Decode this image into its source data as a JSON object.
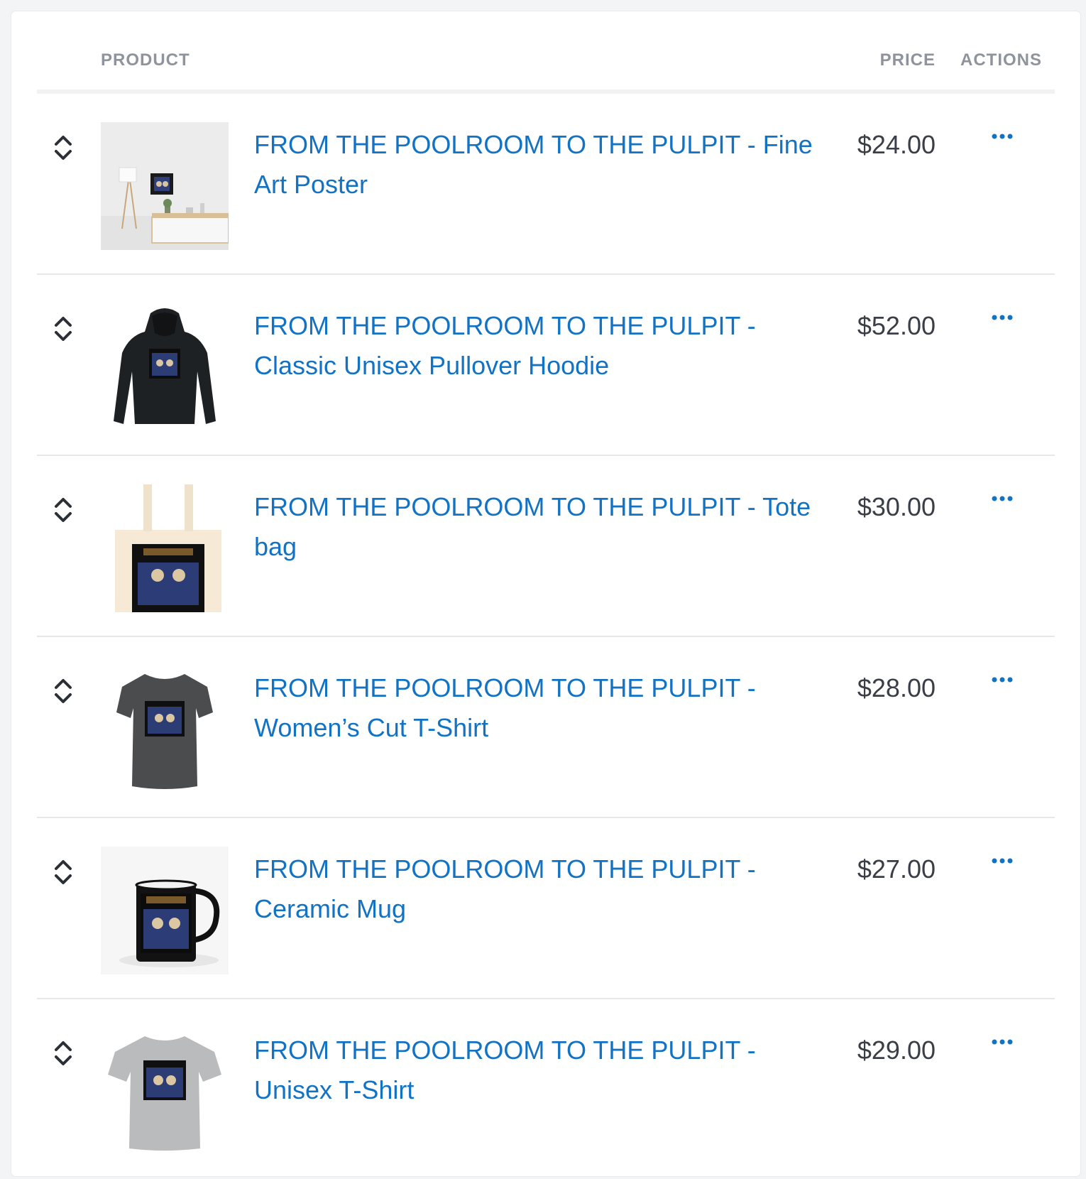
{
  "table": {
    "columns": {
      "product": "PRODUCT",
      "price": "PRICE",
      "actions": "ACTIONS"
    },
    "rows": [
      {
        "name": "FROM THE POOLROOM TO THE PULPIT - Fine Art Poster",
        "price": "$24.00",
        "image": "poster-in-room"
      },
      {
        "name": "FROM THE POOLROOM TO THE PULPIT - Classic Unisex Pullover Hoodie",
        "price": "$52.00",
        "image": "black-hoodie"
      },
      {
        "name": "FROM THE POOLROOM TO THE PULPIT - Tote bag",
        "price": "$30.00",
        "image": "natural-tote-bag"
      },
      {
        "name": "FROM THE POOLROOM TO THE PULPIT - Women’s Cut T-Shirt",
        "price": "$28.00",
        "image": "dark-grey-womens-tshirt"
      },
      {
        "name": "FROM THE POOLROOM TO THE PULPIT - Ceramic Mug",
        "price": "$27.00",
        "image": "black-ceramic-mug"
      },
      {
        "name": "FROM THE POOLROOM TO THE PULPIT - Unisex T-Shirt",
        "price": "$29.00",
        "image": "light-grey-unisex-tshirt"
      }
    ]
  },
  "icons": {
    "sort": "sort-handle-icon",
    "actions": "more-options-icon"
  },
  "colors": {
    "link": "#1272c4",
    "header_text": "#8f949c",
    "price_text": "#3a3f47",
    "divider": "#e6e7ea",
    "background": "#f3f4f6"
  }
}
